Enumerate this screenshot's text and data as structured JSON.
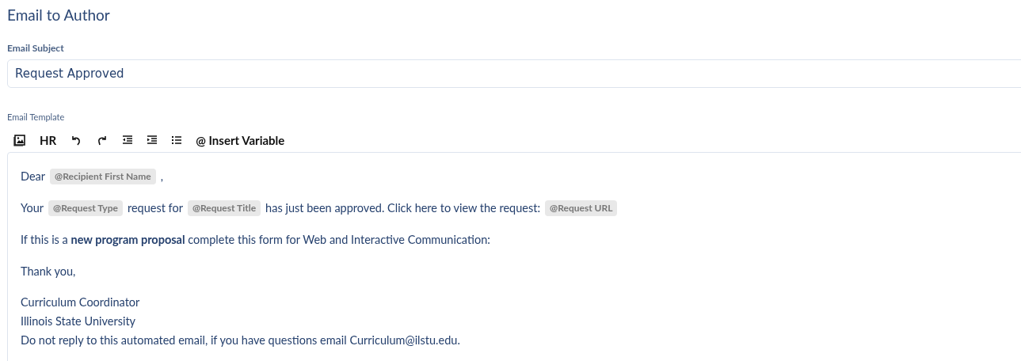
{
  "title": "Email to Author",
  "subject": {
    "label": "Email Subject",
    "value": "Request Approved"
  },
  "template": {
    "label": "Email Template",
    "toolbar": [
      {
        "kind": "image"
      },
      {
        "kind": "text",
        "text": "HR"
      },
      {
        "kind": "undo"
      },
      {
        "kind": "redo"
      },
      {
        "kind": "outdent"
      },
      {
        "kind": "indent"
      },
      {
        "kind": "list"
      },
      {
        "kind": "text",
        "text": "@ Insert Variable"
      }
    ],
    "paragraphs": [
      {
        "parts": [
          {
            "kind": "text",
            "text": "Dear"
          },
          {
            "kind": "variable",
            "text": "@Recipient First Name"
          },
          {
            "kind": "text",
            "text": ","
          }
        ]
      },
      {
        "parts": [
          {
            "kind": "text",
            "text": "Your"
          },
          {
            "kind": "variable",
            "text": "@Request Type"
          },
          {
            "kind": "text",
            "text": "request for"
          },
          {
            "kind": "variable",
            "text": "@Request Title"
          },
          {
            "kind": "text",
            "text": "has just been approved. Click here to view the request:"
          },
          {
            "kind": "variable",
            "text": "@Request URL"
          }
        ]
      },
      {
        "parts": [
          {
            "kind": "text",
            "text": "If this is a **new program proposal** complete this form for Web and Interactive Communication:"
          }
        ]
      },
      {
        "parts": [
          {
            "kind": "text",
            "text": "Thank you,"
          }
        ]
      },
      {
        "lines": [
          "Curriculum Coordinator",
          "Illinois State University",
          "Do not reply to this automated email, if you have questions email Curriculum@ilstu.edu."
        ]
      }
    ]
  }
}
